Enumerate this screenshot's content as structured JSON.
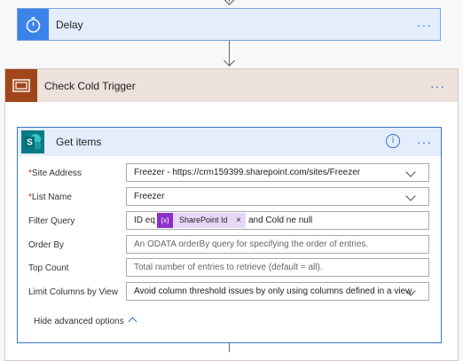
{
  "delay": {
    "title": "Delay",
    "icon": "stopwatch-icon",
    "more": "···"
  },
  "scope": {
    "title": "Check Cold Trigger",
    "icon": "scope-icon",
    "more": "···"
  },
  "get_items": {
    "title": "Get items",
    "icon": "sharepoint-icon",
    "info": "i",
    "more": "···",
    "fields": {
      "site_address": {
        "required_mark": "*",
        "label": "Site Address",
        "value": "Freezer - https://crm159399.sharepoint.com/sites/Freezer"
      },
      "list_name": {
        "required_mark": "*",
        "label": "List Name",
        "value": "Freezer"
      },
      "filter_query": {
        "label": "Filter Query",
        "prefix": "ID eq",
        "token_icon": "{x}",
        "token_label": "SharePoint Id",
        "token_remove": "×",
        "suffix": "and Cold ne null"
      },
      "order_by": {
        "label": "Order By",
        "placeholder": "An ODATA orderBy query for specifying the order of entries."
      },
      "top_count": {
        "label": "Top Count",
        "placeholder": "Total number of entries to retrieve (default = all)."
      },
      "limit_columns": {
        "label": "Limit Columns by View",
        "value": "Avoid column threshold issues by only using columns defined in a view"
      }
    },
    "advanced_toggle": "Hide advanced options"
  },
  "colors": {
    "delay_accent": "#3b82ea",
    "scope_accent": "#a0461b",
    "sharepoint_accent": "#087b83",
    "token_accent": "#8b2fc9"
  }
}
